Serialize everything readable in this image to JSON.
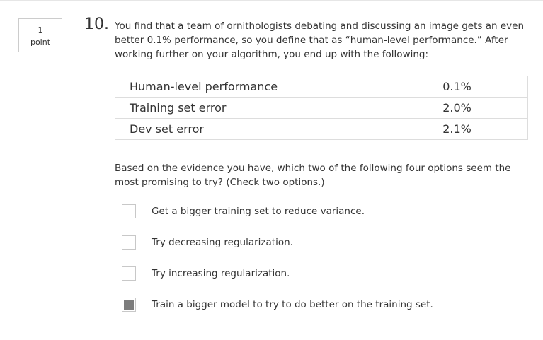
{
  "question": {
    "points_value": "1",
    "points_unit": "point",
    "number": "10.",
    "text": "You find that a team of ornithologists debating and discussing an image gets an even better 0.1% performance, so you define that as “human-level performance.” After working further on your algorithm, you end up with the following:"
  },
  "table": {
    "rows": [
      {
        "metric": "Human-level performance",
        "value": "0.1%"
      },
      {
        "metric": "Training set error",
        "value": "2.0%"
      },
      {
        "metric": "Dev set error",
        "value": "2.1%"
      }
    ]
  },
  "prompt": "Based on the evidence you have, which two of the following four options seem the most promising to try? (Check two options.)",
  "options": [
    {
      "label": "Get a bigger training set to reduce variance.",
      "checked": false
    },
    {
      "label": "Try decreasing regularization.",
      "checked": false
    },
    {
      "label": "Try increasing regularization.",
      "checked": false
    },
    {
      "label": "Train a bigger model to try to do better on the training set.",
      "checked": true
    }
  ]
}
